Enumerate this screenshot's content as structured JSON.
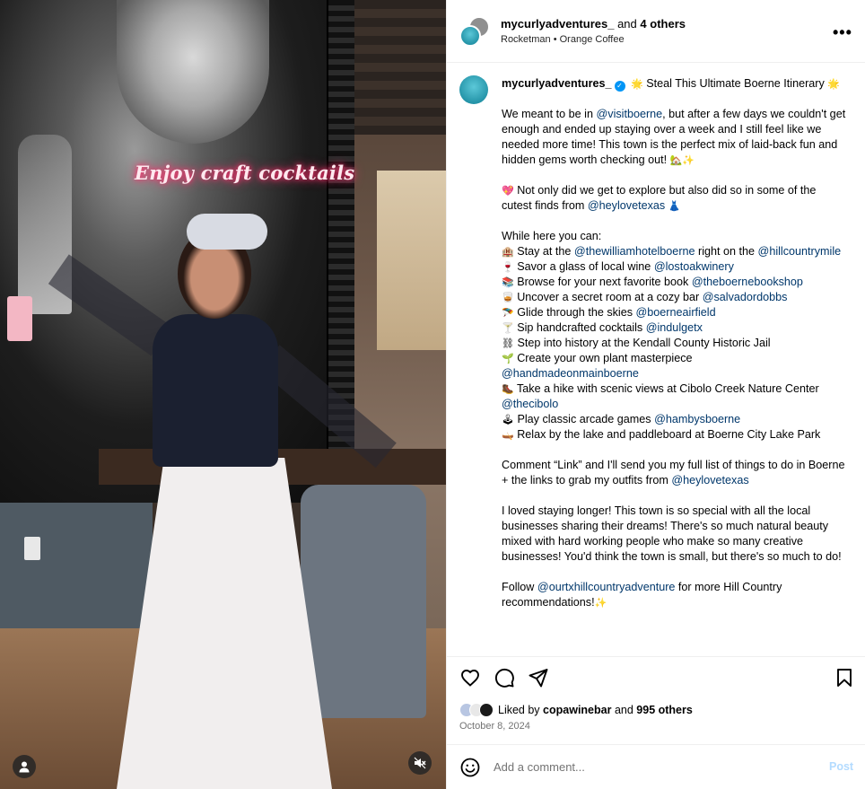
{
  "media": {
    "overlay_text": "Enjoy craft cocktails"
  },
  "header": {
    "username": "mycurlyadventures_",
    "and_text": "and",
    "others": "4 others",
    "music": "Rocketman",
    "separator": "•",
    "location": "Orange Coffee",
    "more_label": "•••"
  },
  "caption": {
    "username": "mycurlyadventures_",
    "title": "Steal This Ultimate Boerne Itinerary",
    "title_emoji": "🌟",
    "title_emoji_end": "🌟",
    "para1_start": "We meant to be in",
    "para1_mention": "@visitboerne",
    "para1_rest": ", but after a few days we couldn't get enough and ended up staying over a week and I still feel like we needed more time! This town is the perfect mix of laid-back fun and hidden gems worth checking out!",
    "para1_emoji": "🏡✨",
    "para2_emoji": "💖",
    "para2_text": "Not only did we get to explore but also did so in some of the cutest finds from",
    "para2_mention": "@heylovetexas",
    "para2_emoji_end": "👗",
    "list_heading": "While here you can:",
    "items": [
      {
        "emoji": "🏨",
        "text": "Stay at the",
        "mention": "@thewilliamhotelboerne",
        "after": "right on the",
        "mention2": "@hillcountrymile"
      },
      {
        "emoji": "🍷",
        "text": "Savor a glass of local wine",
        "mention": "@lostoakwinery"
      },
      {
        "emoji": "📚",
        "text": "Browse for your next favorite book",
        "mention": "@theboernebookshop"
      },
      {
        "emoji": "🥃",
        "text": "Uncover a secret room at a cozy bar",
        "mention": "@salvadordobbs"
      },
      {
        "emoji": "🪂",
        "text": "Glide through the skies",
        "mention": "@boerneairfield"
      },
      {
        "emoji": "🍸",
        "text": "Sip handcrafted cocktails",
        "mention": "@indulgetx"
      },
      {
        "emoji": "⛓",
        "text": "Step into history at the Kendall County Historic Jail",
        "mention": ""
      },
      {
        "emoji": "🌱",
        "text": "Create your own plant masterpiece",
        "mention": "@handmadeonmainboerne"
      },
      {
        "emoji": "🥾",
        "text": "Take a hike with scenic views at Cibolo Creek Nature Center",
        "mention": "@thecibolo"
      },
      {
        "emoji": "🕹",
        "text": "Play classic arcade games",
        "mention": "@hambysboerne"
      },
      {
        "emoji": "🛶",
        "text": "Relax by the lake and paddleboard at Boerne City Lake Park",
        "mention": ""
      }
    ],
    "para3_text": "Comment “Link” and I'll send you my full list of things to do in Boerne + the links to grab my outfits from",
    "para3_mention": "@heylovetexas",
    "para4_text": "I loved staying longer! This town is so special with all the local businesses sharing their dreams! There's so much natural beauty mixed with hard working people who make so many creative businesses! You'd think the town is small, but there's so much to do!",
    "para5_text": "Follow",
    "para5_mention": "@ourtxhillcountryadventure",
    "para5_rest": "for more Hill Country recommendations!",
    "para5_emoji": "✨"
  },
  "likes": {
    "prefix": "Liked by",
    "user": "copawinebar",
    "and": "and",
    "count": "995 others"
  },
  "date": "October 8, 2024",
  "comment": {
    "placeholder": "Add a comment...",
    "post_label": "Post"
  },
  "colors": {
    "mention": "#00376b",
    "post_disabled": "#b3dbff",
    "verified": "#0095f6",
    "overlay_glow": "#ff2f6d"
  }
}
